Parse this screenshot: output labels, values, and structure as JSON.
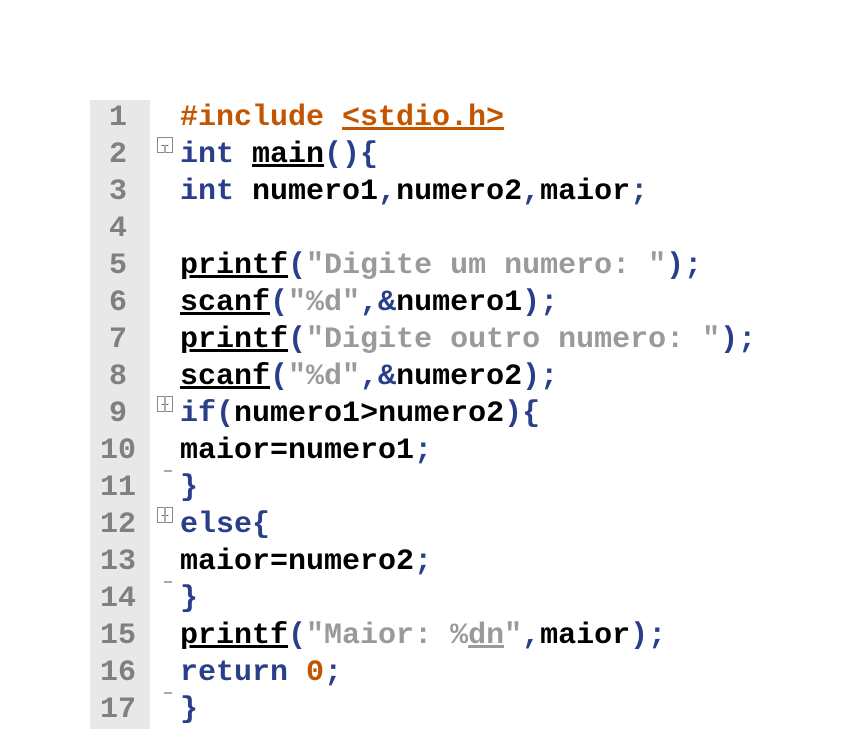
{
  "decoration": {
    "stripes": 10
  },
  "lines": [
    {
      "n": "1",
      "fold": null,
      "html": "<span class='tok-pre'>#include </span><span class='tok-inc'>&lt;stdio.h&gt;</span>"
    },
    {
      "n": "2",
      "fold": "open",
      "html": "<span class='tok-kw'>int</span> <span class='tok-func'>main</span><span class='tok-punc'>(){</span>"
    },
    {
      "n": "3",
      "fold": "line",
      "html": "<span class='tok-kw'>int</span> <span class='tok-id'>numero1</span><span class='tok-punc'>,</span><span class='tok-id'>numero2</span><span class='tok-punc'>,</span><span class='tok-id'>maior</span><span class='tok-punc'>;</span>"
    },
    {
      "n": "4",
      "fold": "line",
      "html": ""
    },
    {
      "n": "5",
      "fold": "line",
      "html": "<span class='tok-func'>printf</span><span class='tok-punc'>(</span><span class='tok-str'>\"Digite um numero: \"</span><span class='tok-punc'>);</span>"
    },
    {
      "n": "6",
      "fold": "line",
      "html": "<span class='tok-func'>scanf</span><span class='tok-punc'>(</span><span class='tok-str'>\"%d\"</span><span class='tok-punc'>,&amp;</span><span class='tok-id'>numero1</span><span class='tok-punc'>);</span>"
    },
    {
      "n": "7",
      "fold": "line",
      "html": "<span class='tok-func'>printf</span><span class='tok-punc'>(</span><span class='tok-str'>\"Digite outro numero: \"</span><span class='tok-punc'>);</span>"
    },
    {
      "n": "8",
      "fold": "line",
      "html": "<span class='tok-func'>scanf</span><span class='tok-punc'>(</span><span class='tok-str'>\"%d\"</span><span class='tok-punc'>,&amp;</span><span class='tok-id'>numero2</span><span class='tok-punc'>);</span>"
    },
    {
      "n": "9",
      "fold": "open",
      "html": "<span class='tok-kw'>if</span><span class='tok-punc'>(</span><span class='tok-id'>numero1</span><span class='tok-op'>&gt;</span><span class='tok-id'>numero2</span><span class='tok-punc'>){</span>"
    },
    {
      "n": "10",
      "fold": "line",
      "html": "<span class='tok-id'>maior</span><span class='tok-op'>=</span><span class='tok-id'>numero1</span><span class='tok-punc'>;</span>"
    },
    {
      "n": "11",
      "fold": "mid",
      "html": "<span class='tok-punc'>}</span>"
    },
    {
      "n": "12",
      "fold": "open",
      "html": "<span class='tok-kw'>else</span><span class='tok-punc'>{</span>"
    },
    {
      "n": "13",
      "fold": "line",
      "html": "<span class='tok-id'>maior</span><span class='tok-op'>=</span><span class='tok-id'>numero2</span><span class='tok-punc'>;</span>"
    },
    {
      "n": "14",
      "fold": "mid",
      "html": "<span class='tok-punc'>}</span>"
    },
    {
      "n": "15",
      "fold": "line",
      "html": "<span class='tok-func'>printf</span><span class='tok-punc'>(</span><span class='tok-str'>\"Maior: %</span><span class='tok-stru'>dn</span><span class='tok-str'>\"</span><span class='tok-punc'>,</span><span class='tok-id'>maior</span><span class='tok-punc'>);</span>"
    },
    {
      "n": "16",
      "fold": "line",
      "html": "<span class='tok-kw'>return</span> <span class='tok-num'>0</span><span class='tok-punc'>;</span>"
    },
    {
      "n": "17",
      "fold": "end",
      "html": "<span class='tok-punc'>}</span>"
    }
  ]
}
